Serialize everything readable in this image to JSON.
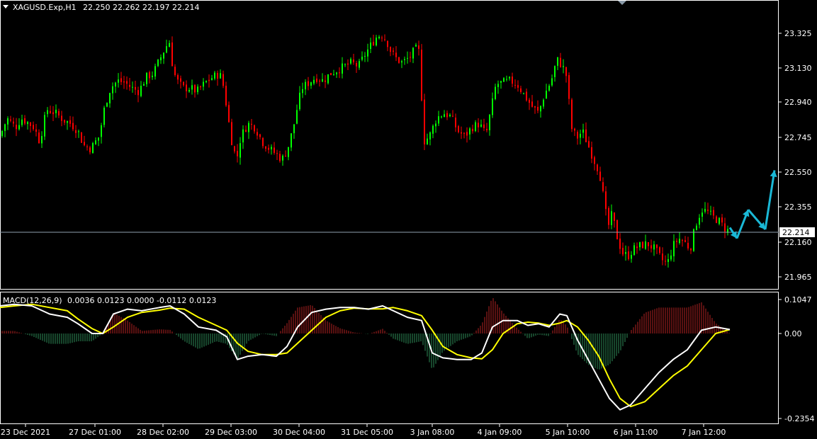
{
  "header": {
    "symbol_label": "XAGUSD.Exp,H1",
    "ohlc_label": "22.250 22.262 22.197 22.214"
  },
  "macd_header": {
    "label": "MACD(12,26,9)",
    "values_label": "0.0036 0.0123 0.0000 -0.0112 0.0123"
  },
  "colors": {
    "bull": "#00ff00",
    "bear": "#ff0000",
    "macd_line": "#ffffff",
    "signal_line": "#ffff00",
    "hist_pos": "#b22222",
    "hist_neg": "#2e8b57",
    "projection": "#1ab8d6",
    "current_price_line": "#8fa0b0",
    "background": "#000000",
    "axis": "#ffffff"
  },
  "chart_data": [
    {
      "type": "candlestick",
      "symbol": "XAGUSD.Exp",
      "timeframe": "H1",
      "ylim": [
        21.88,
        23.48
      ],
      "y_ticks": [
        "23.325",
        "23.130",
        "22.940",
        "22.745",
        "22.550",
        "22.355",
        "22.160",
        "21.965"
      ],
      "current_price": "22.214",
      "x_ticks": [
        "23 Dec 2021",
        "27 Dec 01:00",
        "28 Dec 02:00",
        "29 Dec 03:00",
        "30 Dec 04:00",
        "31 Dec 05:00",
        "3 Jan 08:00",
        "4 Jan 09:00",
        "5 Jan 10:00",
        "6 Jan 11:00",
        "7 Jan 12:00"
      ],
      "close_path": [
        [
          0,
          22.75
        ],
        [
          10,
          22.85
        ],
        [
          22,
          22.8
        ],
        [
          30,
          22.85
        ],
        [
          38,
          22.83
        ],
        [
          48,
          22.8
        ],
        [
          56,
          22.72
        ],
        [
          66,
          22.9
        ],
        [
          78,
          22.88
        ],
        [
          90,
          22.84
        ],
        [
          100,
          22.82
        ],
        [
          110,
          22.78
        ],
        [
          118,
          22.7
        ],
        [
          128,
          22.68
        ],
        [
          140,
          22.75
        ],
        [
          148,
          22.92
        ],
        [
          156,
          23.02
        ],
        [
          166,
          23.06
        ],
        [
          176,
          23.05
        ],
        [
          186,
          23.02
        ],
        [
          196,
          23.0
        ],
        [
          206,
          23.08
        ],
        [
          216,
          23.1
        ],
        [
          222,
          23.15
        ],
        [
          228,
          23.2
        ],
        [
          234,
          23.25
        ],
        [
          240,
          23.28
        ],
        [
          244,
          23.12
        ],
        [
          250,
          23.06
        ],
        [
          258,
          23.02
        ],
        [
          268,
          23.02
        ],
        [
          278,
          23.0
        ],
        [
          290,
          23.05
        ],
        [
          300,
          23.08
        ],
        [
          310,
          23.1
        ],
        [
          316,
          23.02
        ],
        [
          322,
          22.85
        ],
        [
          328,
          22.7
        ],
        [
          334,
          22.62
        ],
        [
          340,
          22.75
        ],
        [
          350,
          22.82
        ],
        [
          360,
          22.8
        ],
        [
          370,
          22.72
        ],
        [
          380,
          22.68
        ],
        [
          390,
          22.65
        ],
        [
          398,
          22.62
        ],
        [
          406,
          22.68
        ],
        [
          414,
          22.8
        ],
        [
          420,
          22.92
        ],
        [
          426,
          23.02
        ],
        [
          436,
          23.05
        ],
        [
          446,
          23.08
        ],
        [
          456,
          23.06
        ],
        [
          466,
          23.1
        ],
        [
          476,
          23.12
        ],
        [
          486,
          23.14
        ],
        [
          496,
          23.16
        ],
        [
          506,
          23.14
        ],
        [
          514,
          23.2
        ],
        [
          522,
          23.25
        ],
        [
          530,
          23.3
        ],
        [
          538,
          23.32
        ],
        [
          546,
          23.28
        ],
        [
          552,
          23.22
        ],
        [
          560,
          23.18
        ],
        [
          568,
          23.16
        ],
        [
          574,
          23.18
        ],
        [
          580,
          23.2
        ],
        [
          586,
          23.24
        ],
        [
          592,
          23.22
        ],
        [
          598,
          22.72
        ],
        [
          606,
          22.75
        ],
        [
          616,
          22.85
        ],
        [
          626,
          22.88
        ],
        [
          636,
          22.86
        ],
        [
          646,
          22.78
        ],
        [
          656,
          22.75
        ],
        [
          666,
          22.8
        ],
        [
          676,
          22.82
        ],
        [
          686,
          22.76
        ],
        [
          692,
          22.88
        ],
        [
          700,
          23.04
        ],
        [
          710,
          23.05
        ],
        [
          720,
          23.06
        ],
        [
          730,
          23.04
        ],
        [
          740,
          22.98
        ],
        [
          750,
          22.92
        ],
        [
          760,
          22.88
        ],
        [
          768,
          22.98
        ],
        [
          778,
          23.06
        ],
        [
          786,
          23.18
        ],
        [
          794,
          23.14
        ],
        [
          800,
          23.08
        ],
        [
          806,
          22.8
        ],
        [
          814,
          22.74
        ],
        [
          822,
          22.78
        ],
        [
          830,
          22.7
        ],
        [
          838,
          22.62
        ],
        [
          846,
          22.55
        ],
        [
          852,
          22.4
        ],
        [
          858,
          22.24
        ],
        [
          864,
          22.32
        ],
        [
          870,
          22.2
        ],
        [
          878,
          22.1
        ],
        [
          886,
          22.08
        ],
        [
          894,
          22.12
        ],
        [
          904,
          22.14
        ],
        [
          914,
          22.15
        ],
        [
          924,
          22.12
        ],
        [
          934,
          22.06
        ],
        [
          942,
          22.04
        ],
        [
          950,
          22.14
        ],
        [
          958,
          22.18
        ],
        [
          966,
          22.16
        ],
        [
          974,
          22.12
        ],
        [
          982,
          22.26
        ],
        [
          990,
          22.34
        ],
        [
          998,
          22.33
        ],
        [
          1006,
          22.3
        ],
        [
          1014,
          22.28
        ],
        [
          1022,
          22.24
        ],
        [
          1030,
          22.214
        ]
      ],
      "projection_arrows": [
        [
          1030,
          22.24
        ],
        [
          1040,
          22.18
        ],
        [
          1056,
          22.34
        ],
        [
          1080,
          22.23
        ],
        [
          1093,
          22.56
        ]
      ]
    },
    {
      "type": "line",
      "title": "MACD(12,26,9)",
      "ylim": [
        -0.2354,
        0.1047
      ],
      "y_ticks": [
        "0.1047",
        "0.00",
        "-0.2354"
      ],
      "series": [
        {
          "name": "MACD",
          "points": [
            [
              0,
              0.085
            ],
            [
              20,
              0.09
            ],
            [
              45,
              0.085
            ],
            [
              70,
              0.06
            ],
            [
              95,
              0.05
            ],
            [
              110,
              0.03
            ],
            [
              130,
              0.0
            ],
            [
              145,
              0.0
            ],
            [
              160,
              0.06
            ],
            [
              180,
              0.075
            ],
            [
              200,
              0.07
            ],
            [
              225,
              0.08
            ],
            [
              240,
              0.085
            ],
            [
              260,
              0.06
            ],
            [
              280,
              0.02
            ],
            [
              305,
              0.01
            ],
            [
              320,
              -0.01
            ],
            [
              335,
              -0.08
            ],
            [
              350,
              -0.07
            ],
            [
              370,
              -0.065
            ],
            [
              390,
              -0.07
            ],
            [
              405,
              -0.04
            ],
            [
              420,
              0.02
            ],
            [
              440,
              0.065
            ],
            [
              460,
              0.075
            ],
            [
              480,
              0.08
            ],
            [
              500,
              0.08
            ],
            [
              520,
              0.075
            ],
            [
              540,
              0.085
            ],
            [
              555,
              0.07
            ],
            [
              575,
              0.05
            ],
            [
              595,
              0.04
            ],
            [
              610,
              -0.06
            ],
            [
              625,
              -0.075
            ],
            [
              645,
              -0.08
            ],
            [
              665,
              -0.08
            ],
            [
              680,
              -0.06
            ],
            [
              695,
              0.02
            ],
            [
              710,
              0.04
            ],
            [
              730,
              0.04
            ],
            [
              745,
              0.025
            ],
            [
              760,
              0.03
            ],
            [
              775,
              0.02
            ],
            [
              790,
              0.06
            ],
            [
              800,
              0.055
            ],
            [
              815,
              -0.02
            ],
            [
              830,
              -0.08
            ],
            [
              845,
              -0.14
            ],
            [
              860,
              -0.2
            ],
            [
              875,
              -0.235
            ],
            [
              890,
              -0.22
            ],
            [
              910,
              -0.17
            ],
            [
              930,
              -0.12
            ],
            [
              950,
              -0.08
            ],
            [
              970,
              -0.05
            ],
            [
              990,
              0.01
            ],
            [
              1010,
              0.02
            ],
            [
              1030,
              0.0123
            ]
          ]
        },
        {
          "name": "Signal",
          "points": [
            [
              0,
              0.08
            ],
            [
              20,
              0.085
            ],
            [
              45,
              0.09
            ],
            [
              70,
              0.08
            ],
            [
              95,
              0.07
            ],
            [
              110,
              0.045
            ],
            [
              130,
              0.015
            ],
            [
              145,
              0.0
            ],
            [
              160,
              0.02
            ],
            [
              180,
              0.05
            ],
            [
              200,
              0.065
            ],
            [
              225,
              0.072
            ],
            [
              240,
              0.078
            ],
            [
              260,
              0.075
            ],
            [
              280,
              0.05
            ],
            [
              305,
              0.025
            ],
            [
              320,
              0.01
            ],
            [
              335,
              -0.03
            ],
            [
              350,
              -0.055
            ],
            [
              370,
              -0.065
            ],
            [
              390,
              -0.065
            ],
            [
              405,
              -0.06
            ],
            [
              420,
              -0.03
            ],
            [
              440,
              0.01
            ],
            [
              460,
              0.05
            ],
            [
              480,
              0.07
            ],
            [
              500,
              0.078
            ],
            [
              520,
              0.076
            ],
            [
              540,
              0.076
            ],
            [
              555,
              0.08
            ],
            [
              575,
              0.07
            ],
            [
              595,
              0.055
            ],
            [
              610,
              0.01
            ],
            [
              625,
              -0.04
            ],
            [
              645,
              -0.065
            ],
            [
              665,
              -0.075
            ],
            [
              680,
              -0.078
            ],
            [
              695,
              -0.05
            ],
            [
              710,
              0.0
            ],
            [
              730,
              0.03
            ],
            [
              745,
              0.035
            ],
            [
              760,
              0.032
            ],
            [
              775,
              0.025
            ],
            [
              790,
              0.032
            ],
            [
              800,
              0.04
            ],
            [
              815,
              0.02
            ],
            [
              830,
              -0.02
            ],
            [
              845,
              -0.07
            ],
            [
              860,
              -0.14
            ],
            [
              875,
              -0.2
            ],
            [
              890,
              -0.225
            ],
            [
              910,
              -0.21
            ],
            [
              930,
              -0.17
            ],
            [
              950,
              -0.13
            ],
            [
              970,
              -0.1
            ],
            [
              990,
              -0.05
            ],
            [
              1010,
              0.0
            ],
            [
              1030,
              0.0123
            ]
          ]
        }
      ]
    }
  ]
}
